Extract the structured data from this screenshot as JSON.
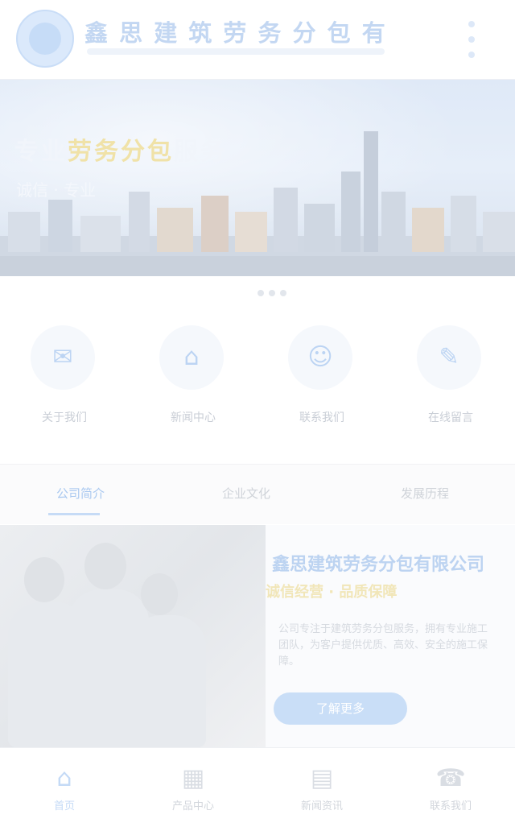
{
  "header": {
    "company_name": "鑫 思 建 筑 劳 务 分 包 有 限 公 司",
    "logo_icon": "company-logo-icon",
    "menu_icon": "more-vertical-icon"
  },
  "banner": {
    "title_part1": "专业",
    "title_part2": "劳务分包",
    "title_part3": "服务",
    "subtitle": "诚信 · 专业"
  },
  "quick_links": [
    {
      "label": "关于我们",
      "icon": "mail-icon"
    },
    {
      "label": "新闻中心",
      "icon": "home-icon"
    },
    {
      "label": "联系我们",
      "icon": "user-icon"
    },
    {
      "label": "在线留言",
      "icon": "chat-icon"
    }
  ],
  "tabs": [
    {
      "label": "公司简介"
    },
    {
      "label": "企业文化"
    },
    {
      "label": "发展历程"
    }
  ],
  "feature": {
    "title": "鑫思建筑劳务分包有限公司",
    "subtitle": "诚信经营 · 品质保障",
    "text": "公司专注于建筑劳务分包服务，拥有专业施工团队，为客户提供优质、高效、安全的施工保障。",
    "button_label": "了解更多"
  },
  "bottom_nav": [
    {
      "label": "首页",
      "icon": "home-icon"
    },
    {
      "label": "产品中心",
      "icon": "grid-icon"
    },
    {
      "label": "新闻资讯",
      "icon": "news-icon"
    },
    {
      "label": "联系我们",
      "icon": "phone-icon"
    }
  ],
  "colors": {
    "accent": "#c4daf6",
    "highlight": "#f0e2a8"
  }
}
